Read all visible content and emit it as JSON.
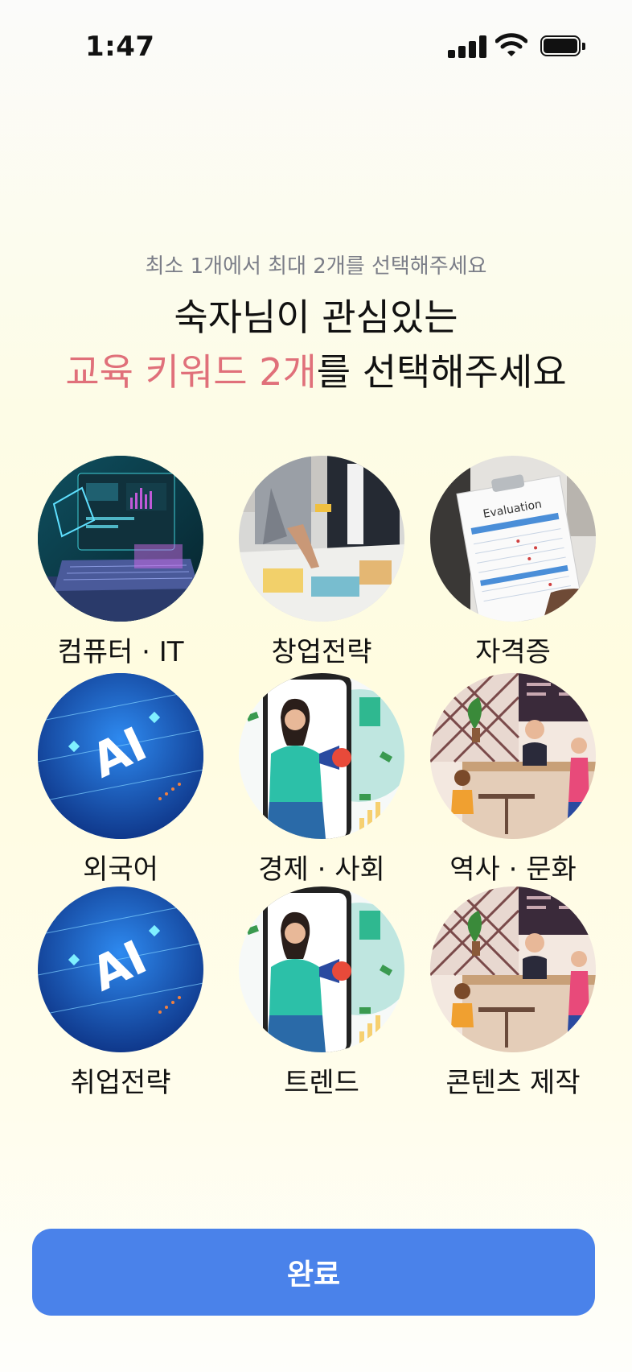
{
  "status_bar": {
    "time": "1:47"
  },
  "header": {
    "subtitle": "최소 1개에서 최대 2개를 선택해주세요",
    "title_line1": "숙자님이 관심있는",
    "title_line2_accent": "교육 키워드 2개",
    "title_line2_rest": "를 선택해주세요"
  },
  "keywords": [
    {
      "label": "컴퓨터 · IT",
      "image": "laptop-dashboard"
    },
    {
      "label": "창업전략",
      "image": "business-meeting"
    },
    {
      "label": "자격증",
      "image": "evaluation-form"
    },
    {
      "label": "외국어",
      "image": "ai-chip"
    },
    {
      "label": "경제 · 사회",
      "image": "phone-marketer"
    },
    {
      "label": "역사 · 문화",
      "image": "cafe-scene"
    },
    {
      "label": "취업전략",
      "image": "ai-chip"
    },
    {
      "label": "트렌드",
      "image": "phone-marketer"
    },
    {
      "label": "콘텐츠 제작",
      "image": "cafe-scene"
    }
  ],
  "image_text": {
    "evaluation": "Evaluation",
    "ai": "AI"
  },
  "footer": {
    "complete_label": "완료"
  },
  "colors": {
    "accent": "#e0707a",
    "button": "#4a82ea",
    "subtitle": "#7b7e88"
  }
}
